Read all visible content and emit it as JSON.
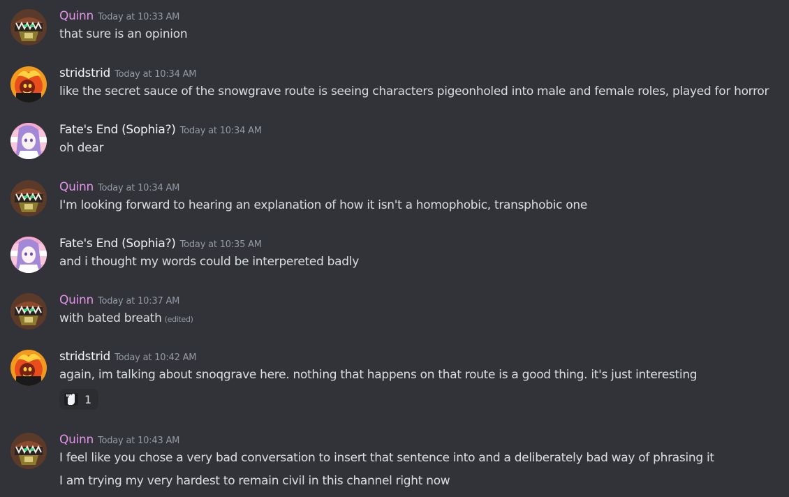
{
  "colors": {
    "background": "#313338",
    "quinn_name": "#e394e8",
    "white_name": "#f2f3f5",
    "timestamp": "#949ba4",
    "text": "#dbdee1"
  },
  "messages": [
    {
      "username": "Quinn",
      "timestamp": "Today at 10:33 AM",
      "lines": [
        "that sure is an opinion"
      ]
    },
    {
      "username": "stridstrid",
      "timestamp": "Today at 10:34 AM",
      "lines": [
        "like the secret sauce of the snowgrave route is seeing characters pigeonholed into male and female roles, played for horror"
      ]
    },
    {
      "username": "Fate's End (Sophia?)",
      "timestamp": "Today at 10:34 AM",
      "lines": [
        "oh dear"
      ]
    },
    {
      "username": "Quinn",
      "timestamp": "Today at 10:34 AM",
      "lines": [
        "I'm looking forward to hearing an explanation of how it isn't a homophobic, transphobic one"
      ]
    },
    {
      "username": "Fate's End (Sophia?)",
      "timestamp": "Today at 10:35 AM",
      "lines": [
        "and i thought my words could be interpereted badly"
      ]
    },
    {
      "username": "Quinn",
      "timestamp": "Today at 10:37 AM",
      "lines": [
        "with bated breath"
      ],
      "edited": "(edited)"
    },
    {
      "username": "stridstrid",
      "timestamp": "Today at 10:42 AM",
      "lines": [
        "again, im talking about snoqgrave here. nothing that happens on that route is a good thing. it's just interesting"
      ],
      "reaction": {
        "emoji": "hand-emoji",
        "count": "1"
      }
    },
    {
      "username": "Quinn",
      "timestamp": "Today at 10:43 AM",
      "lines": [
        "I feel like you chose a very bad conversation to insert that sentence into and a deliberately bad way of phrasing it",
        "I am trying my very hardest to remain civil in this channel right now"
      ]
    }
  ]
}
